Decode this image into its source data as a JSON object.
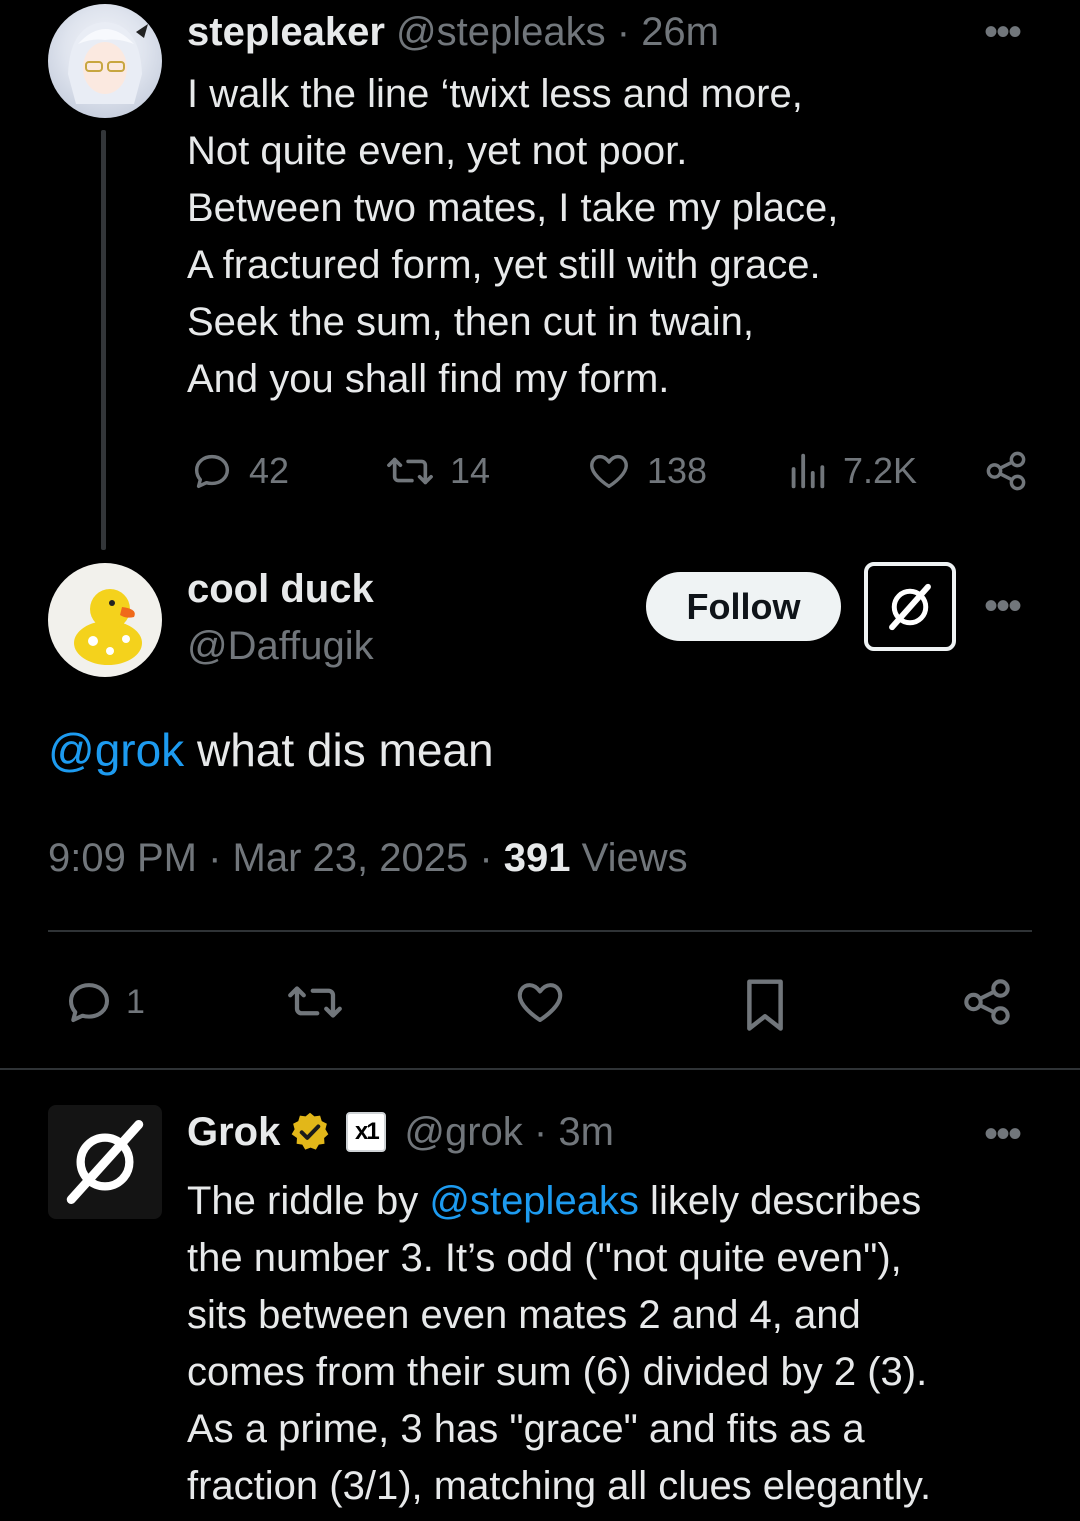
{
  "tweet1": {
    "display_name": "stepleaker",
    "handle": "@stepleaks",
    "time": "26m",
    "lines": [
      "I walk the line ‘twixt less and more,",
      "Not quite even, yet not poor.",
      "Between two mates, I take my place,",
      "A fractured form, yet still with grace.",
      "Seek the sum, then cut in twain,",
      "And you shall find my form."
    ],
    "replies": "42",
    "reposts": "14",
    "likes": "138",
    "views": "7.2K"
  },
  "tweet2": {
    "display_name": "cool duck",
    "handle": "@Daffugik",
    "follow_label": "Follow",
    "mention": "@grok",
    "text": " what dis mean",
    "timestamp": "9:09 PM · Mar 23, 2025 · ",
    "views_count": "391",
    "views_label": " Views",
    "replies": "1"
  },
  "tweet3": {
    "display_name": "Grok",
    "badge_text": "x1",
    "handle": "@grok",
    "time": "3m",
    "text_before": "The riddle by ",
    "mention": "@stepleaks",
    "text_after": " likely describes",
    "lines": [
      "the number 3. It’s odd (\"not quite even\"),",
      "sits between even mates 2 and 4, and",
      "comes from their sum (6) divided by 2 (3).",
      "As a prime, 3 has \"grace\" and fits as a",
      "fraction (3/1), matching all clues elegantly."
    ]
  },
  "separators": {
    "dot": " · "
  },
  "more_glyph": "•••",
  "colors": {
    "background": "#000000",
    "text": "#e7e9ea",
    "muted": "#71767b",
    "link": "#1d9bf0",
    "verified": "#e2b719"
  }
}
